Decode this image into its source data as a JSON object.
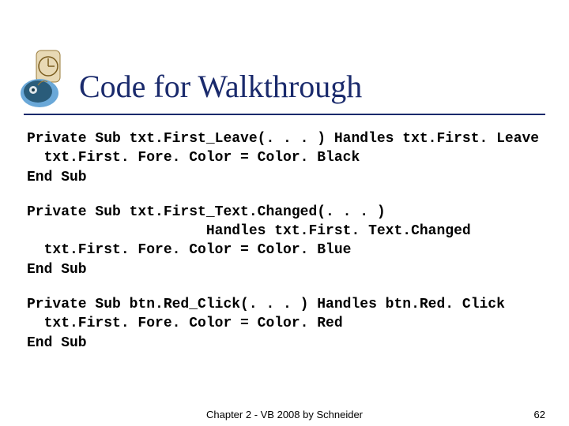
{
  "title": "Code for Walkthrough",
  "code": {
    "block1": {
      "l1": "Private Sub txt.First_Leave(. . . ) Handles txt.First. Leave",
      "l2": "  txt.First. Fore. Color = Color. Black",
      "l3": "End Sub"
    },
    "block2": {
      "l1": "Private Sub txt.First_Text.Changed(. . . )",
      "l2": "                     Handles txt.First. Text.Changed",
      "l3": "  txt.First. Fore. Color = Color. Blue",
      "l4": "End Sub"
    },
    "block3": {
      "l1": "Private Sub btn.Red_Click(. . . ) Handles btn.Red. Click",
      "l2": "  txt.First. Fore. Color = Color. Red",
      "l3": "End Sub"
    }
  },
  "footer": {
    "center": "Chapter 2 - VB 2008 by Schneider",
    "pagenum": "62"
  }
}
